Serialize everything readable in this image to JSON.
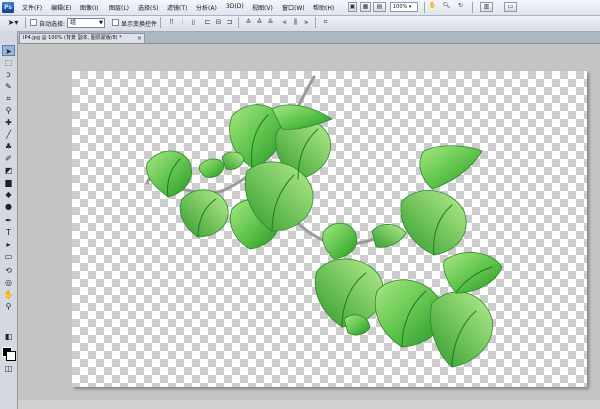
{
  "app": {
    "logo": "Ps"
  },
  "menu": {
    "items": [
      "文件(F)",
      "编辑(E)",
      "图像(I)",
      "图层(L)",
      "选择(S)",
      "滤镜(T)",
      "分析(A)",
      "3D(D)",
      "视图(V)",
      "窗口(W)",
      "帮助(H)"
    ],
    "zoom": "100%"
  },
  "options": {
    "auto_select_label": "自动选择:",
    "auto_select_value": "组",
    "show_transform_label": "显示变换控件"
  },
  "document": {
    "tab_title": "IP4.jpg @ 100% (背景 副本, 图层蒙版/8) *",
    "close": "×"
  },
  "colors": {
    "leaf_light": "#9fe07a",
    "leaf_dark": "#2f9e2c",
    "vein": "#1f7a1f",
    "stem": "#9a9a9a"
  }
}
